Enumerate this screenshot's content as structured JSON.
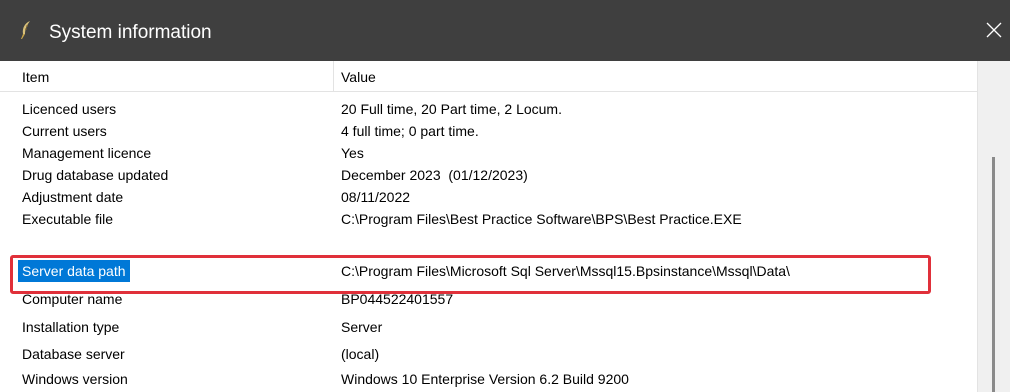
{
  "window": {
    "title": "System information",
    "app_icon": "quill-icon",
    "close_icon": "close-icon"
  },
  "table": {
    "columns": [
      "Item",
      "Value"
    ],
    "rows": [
      {
        "item": "Licenced users",
        "value": "20 Full time, 20 Part time, 2 Locum."
      },
      {
        "item": "Current users",
        "value": "4 full time; 0 part time."
      },
      {
        "item": "Management licence",
        "value": "Yes"
      },
      {
        "item": "Drug database updated",
        "value": "December 2023  (01/12/2023)"
      },
      {
        "item": "Adjustment date",
        "value": "08/11/2022"
      },
      {
        "item": "Executable file",
        "value": "C:\\Program Files\\Best Practice Software\\BPS\\Best Practice.EXE"
      },
      {
        "item": "Server data path",
        "value": "C:\\Program Files\\Microsoft Sql Server\\Mssql15.Bpsinstance\\Mssql\\Data\\"
      },
      {
        "item": "Computer name",
        "value": "BP044522401557"
      },
      {
        "item": "Installation type",
        "value": "Server"
      },
      {
        "item": "Database server",
        "value": "(local)"
      },
      {
        "item": "Windows version",
        "value": "Windows 10 Enterprise Version 6.2 Build 9200"
      }
    ],
    "selected_row": "Server data path"
  },
  "colors": {
    "titlebar": "#3f3f3f",
    "selection": "#0078d7",
    "highlight_box": "#e0303a"
  }
}
